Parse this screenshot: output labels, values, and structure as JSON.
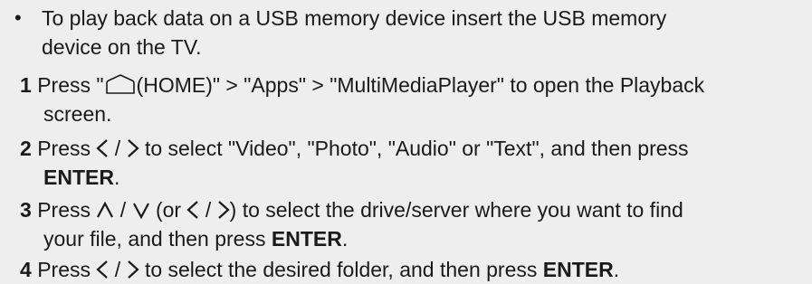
{
  "intro": {
    "bullet": "•",
    "line1": "To play back data on a USB memory device insert the USB memory",
    "line2": "device on the TV."
  },
  "steps": [
    {
      "number": "1",
      "press": "Press \"",
      "home_label": "(HOME)\" > \"Apps\" > \"MultiMediaPlayer\" to open the Playback",
      "cont": "screen.",
      "icon": "home-icon"
    },
    {
      "number": "2",
      "press": "Press",
      "sep": "/",
      "text": "to select \"Video\", \"Photo\", \"Audio\" or \"Text\", and then press",
      "key": "ENTER",
      "end": ".",
      "icons": [
        "left-arrow-icon",
        "right-arrow-icon"
      ]
    },
    {
      "number": "3",
      "press": "Press",
      "sep": "/",
      "paren_open": "(or",
      "paren_close": ")",
      "text": "to select the drive/server where you want to find",
      "cont": "your file, and then press",
      "key": "ENTER",
      "end": ".",
      "icons": [
        "up-arrow-icon",
        "down-arrow-icon",
        "left-arrow-icon",
        "right-arrow-icon"
      ]
    },
    {
      "number": "4",
      "press": "Press",
      "sep": "/",
      "text": "to select the desired folder, and then press",
      "key": "ENTER",
      "end": ".",
      "icons": [
        "left-arrow-icon",
        "right-arrow-icon"
      ]
    }
  ]
}
